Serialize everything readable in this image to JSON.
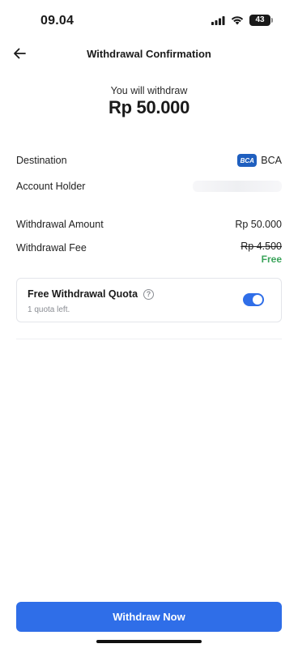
{
  "status_bar": {
    "time": "09.04",
    "battery_level": "43",
    "icons": [
      "cellular-signal-icon",
      "wifi-icon",
      "battery-icon"
    ]
  },
  "header": {
    "title": "Withdrawal Confirmation",
    "back_icon": "arrow-left-icon"
  },
  "amount": {
    "caption": "You will withdraw",
    "value": "Rp 50.000"
  },
  "details": {
    "destination": {
      "label": "Destination",
      "bank_logo_text": "BCA",
      "bank_name": "BCA"
    },
    "account_holder": {
      "label": "Account Holder"
    },
    "withdrawal_amount": {
      "label": "Withdrawal Amount",
      "value": "Rp 50.000"
    },
    "withdrawal_fee": {
      "label": "Withdrawal Fee",
      "original_value": "Rp 4.500",
      "value": "Free"
    }
  },
  "quota": {
    "title": "Free Withdrawal Quota",
    "help_glyph": "?",
    "subtitle": "1 quota left.",
    "toggle_on": true
  },
  "actions": {
    "withdraw_label": "Withdraw Now"
  },
  "colors": {
    "primary": "#2f6ee8",
    "free": "#3aa35a",
    "bank_logo": "#1f5fbf"
  }
}
